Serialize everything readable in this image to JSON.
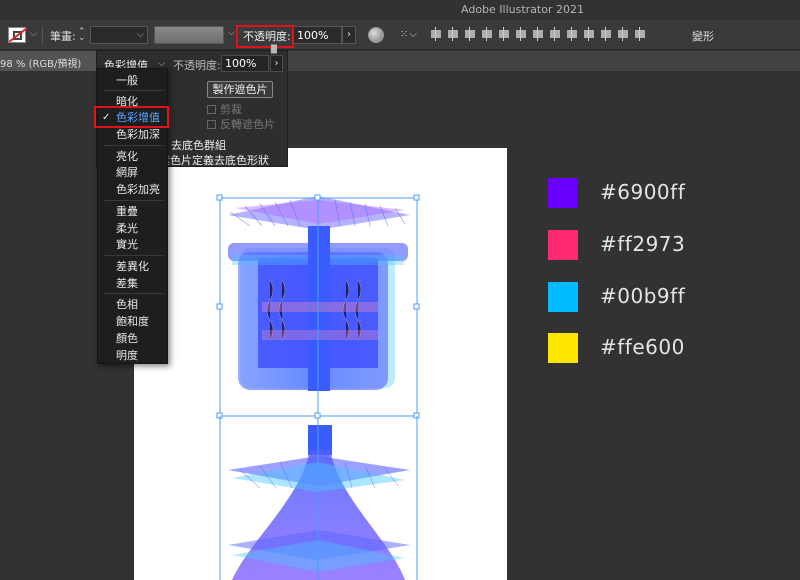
{
  "app": {
    "title": "Adobe Illustrator 2021"
  },
  "control_bar": {
    "stroke_label": "筆畫:",
    "opacity_label": "不透明度:",
    "opacity_value": "100%",
    "transform_label": "變形"
  },
  "document": {
    "tab_label": "98 % (RGB/預視)"
  },
  "transparency_panel": {
    "blend_mode": "色彩增值",
    "opacity_label": "不透明度:",
    "opacity_value": "100%",
    "make_mask_button": "製作遮色片",
    "clip_label": "剪裁",
    "invert_mask_label": "反轉遮色片",
    "knockout_group_label": "去底色群組",
    "opacity_mask_knockout_label": "遮色片定義去底色形狀"
  },
  "blend_menu": {
    "items": [
      {
        "label": "一般"
      },
      {
        "label": "暗化"
      },
      {
        "label": "色彩增值",
        "selected": true
      },
      {
        "label": "色彩加深"
      },
      {
        "label": "亮化"
      },
      {
        "label": "網屏"
      },
      {
        "label": "色彩加亮"
      },
      {
        "label": "重疊"
      },
      {
        "label": "柔光"
      },
      {
        "label": "實光"
      },
      {
        "label": "差異化"
      },
      {
        "label": "差集"
      },
      {
        "label": "色相"
      },
      {
        "label": "飽和度"
      },
      {
        "label": "顏色"
      },
      {
        "label": "明度"
      }
    ],
    "check_glyph": "✓"
  },
  "palette": [
    {
      "hex_label": "#6900ff",
      "color": "#6900ff"
    },
    {
      "hex_label": "#ff2973",
      "color": "#ff2973"
    },
    {
      "hex_label": "#00b9ff",
      "color": "#00b9ff"
    },
    {
      "hex_label": "#ffe600",
      "color": "#ffe600"
    }
  ],
  "highlight_color": "#e0121c"
}
